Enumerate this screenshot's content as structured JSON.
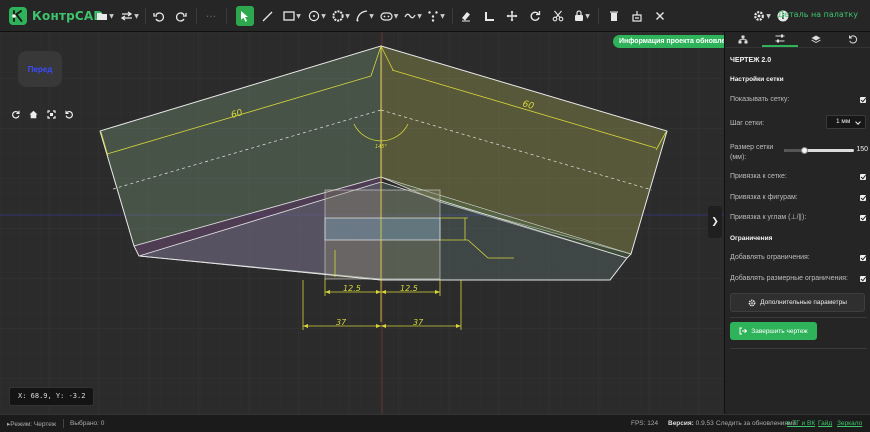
{
  "app": {
    "name": "КонтрCAD",
    "accent": "#2fb35a"
  },
  "toolbar": {
    "file_icon": "folder-icon",
    "transfer_icon": "swap-arrows-icon",
    "undo_icon": "undo-icon",
    "redo_icon": "redo-icon",
    "more_icon": "ellipsis-icon",
    "tools": [
      {
        "name": "select-tool",
        "icon": "cursor-icon",
        "active": true
      },
      {
        "name": "line-tool",
        "icon": "line-icon"
      },
      {
        "name": "rectangle-tool",
        "icon": "rectangle-icon"
      },
      {
        "name": "circle-tool",
        "icon": "circle-icon"
      },
      {
        "name": "polygon-tool",
        "icon": "gear-polygon-icon"
      },
      {
        "name": "arc-tool",
        "icon": "arc-icon"
      },
      {
        "name": "slot-tool",
        "icon": "slot-icon"
      },
      {
        "name": "spline-tool",
        "icon": "spline-icon"
      },
      {
        "name": "points-tool",
        "icon": "points-icon"
      },
      {
        "name": "eraser-tool",
        "icon": "eraser-icon"
      },
      {
        "name": "fillet-tool",
        "icon": "fillet-icon"
      },
      {
        "name": "move-tool",
        "icon": "move-icon"
      },
      {
        "name": "rotate-tool",
        "icon": "rotate-icon"
      },
      {
        "name": "trim-tool",
        "icon": "scissors-icon"
      },
      {
        "name": "constraint-tool",
        "icon": "lock-icon"
      },
      {
        "name": "delete-tool",
        "icon": "trash-icon"
      },
      {
        "name": "clear-tool",
        "icon": "broom-icon"
      },
      {
        "name": "close-tool",
        "icon": "close-icon"
      }
    ],
    "settings_icon": "gear-icon",
    "info_icon": "info-icon",
    "back_link": "Деталь на палатку"
  },
  "canvas": {
    "notice": "Информация проекта обновлена",
    "view_label": "Перед",
    "coords": "X: 68.9, Y: -3.2",
    "dimensions": {
      "left_top": "60",
      "right_top": "60",
      "angle": "145°",
      "bottom_left_inner": "12.5",
      "bottom_right_inner": "12.5",
      "bottom_left_outer": "37",
      "bottom_right_outer": "37"
    }
  },
  "panel": {
    "title": "ЧЕРТЕЖ 2.0",
    "grid_section": "Настройки сетки",
    "show_grid": "Показывать сетку:",
    "grid_step": "Шаг сетки:",
    "grid_step_value": "1 мм",
    "grid_size": "Размер сетки (мм):",
    "grid_size_value": "150",
    "snap_grid": "Привязка к сетке:",
    "snap_shapes": "Привязка к фигурам:",
    "snap_angles": "Привязка к углам (⊥/∥):",
    "constraints_section": "Ограничения",
    "add_constraints": "Добавлять ограничения:",
    "add_dim_constraints": "Добавлять размерные ограничения:",
    "advanced_button": "Дополнительные параметры",
    "finish_button": "Завершить чертеж"
  },
  "status": {
    "mode": "Режим: Чертеж",
    "selected": "Выбрано: 0",
    "fps": "FPS: 124",
    "version_label": "Версия:",
    "version_value": "0.9.53",
    "follow": "Следить за обновлениями:",
    "tg_vk": "в ТГ и ВК",
    "help": "Гайд",
    "mirror": "Зеркало"
  }
}
